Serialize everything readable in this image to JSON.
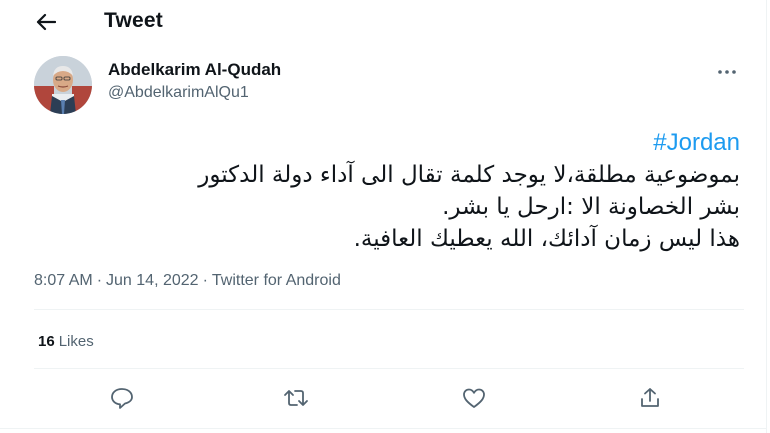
{
  "header": {
    "title": "Tweet",
    "back_icon": "arrow-left-icon"
  },
  "author": {
    "display_name": "Abdelkarim Al-Qudah",
    "handle": "@AbdelkarimAlQu1",
    "more_icon": "more-dots-icon"
  },
  "tweet": {
    "hashtag": "#Jordan",
    "lines": [
      "بموضوعية مطلقة،لا يوجد كلمة تقال الى آداء دولة الدكتور",
      "بشر الخصاونة الا :ارحل يا بشر.",
      "هذا ليس زمان آدائك، الله يعطيك العافية."
    ]
  },
  "meta": {
    "time": "8:07 AM",
    "separator": "·",
    "date": "Jun 14, 2022",
    "source": "Twitter for Android"
  },
  "engagement": {
    "likes_count": "16",
    "likes_label": "Likes"
  },
  "actions": [
    {
      "name": "reply-icon"
    },
    {
      "name": "retweet-icon"
    },
    {
      "name": "like-icon"
    },
    {
      "name": "share-icon"
    }
  ],
  "colors": {
    "accent": "#1d9bf0",
    "text": "#0f1419",
    "secondary": "#536471",
    "border": "#eff3f4"
  }
}
